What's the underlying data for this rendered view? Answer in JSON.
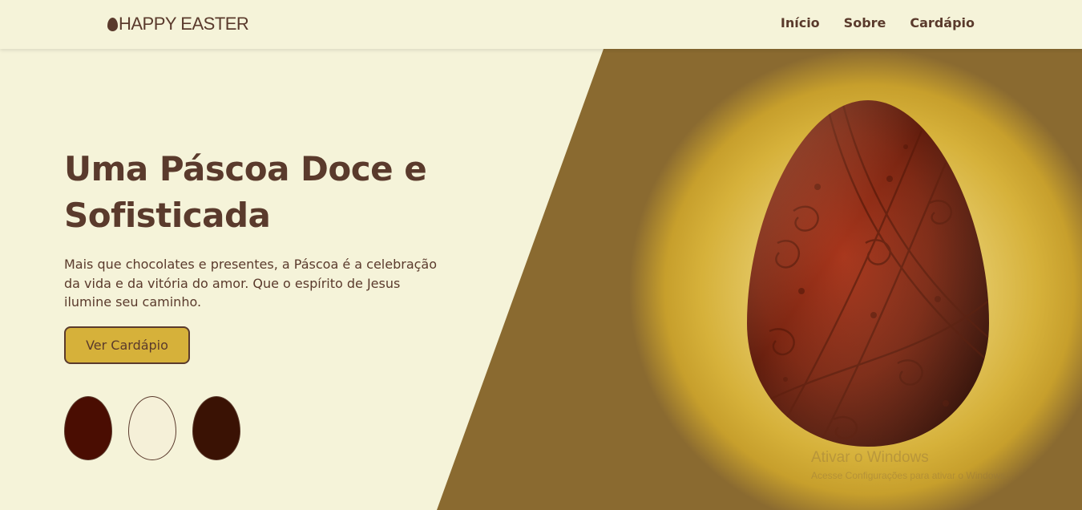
{
  "header": {
    "logo_text": "HAPPY EASTER",
    "nav": [
      {
        "label": "Início"
      },
      {
        "label": "Sobre"
      },
      {
        "label": "Cardápio"
      }
    ]
  },
  "hero": {
    "title": "Uma Páscoa Doce e Sofisticada",
    "description": "Mais que chocolates e presentes, a Páscoa é a celebração da vida e da vitória do amor. Que o espírito de Jesus ilumine seu caminho.",
    "button_label": "Ver Cardápio",
    "swatches": [
      {
        "color": "#4a0d02"
      },
      {
        "color": "#f5f0d8"
      },
      {
        "color": "#3a1204"
      }
    ],
    "accent_color": "#d6b13a",
    "text_color": "#5a3a2c"
  },
  "watermark": {
    "title": "Ativar o Windows",
    "subtitle": "Acesse Configurações para ativar o Windows."
  }
}
